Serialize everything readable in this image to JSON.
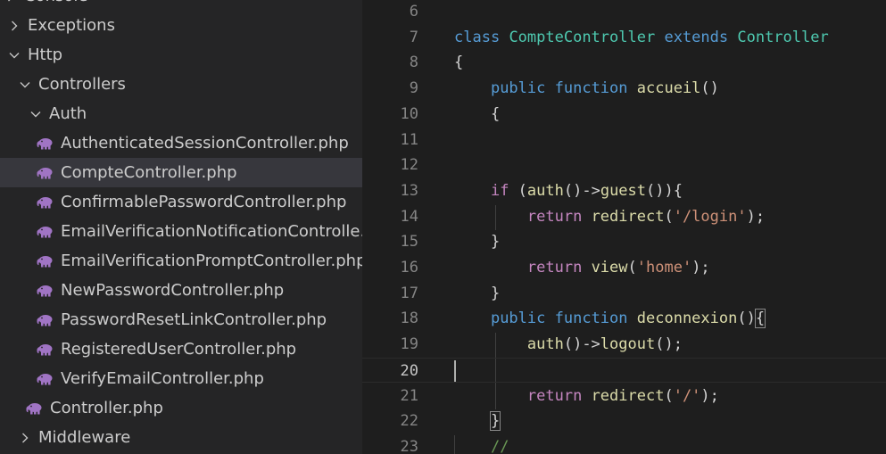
{
  "colors": {
    "sidebar_bg": "#252526",
    "editor_bg": "#1e1e1e",
    "selected_row": "#37373d",
    "php_icon": "#a074c4",
    "keyword": "#569cd6",
    "control_keyword": "#c586c0",
    "class_name": "#4ec9b0",
    "function_name": "#dcdcaa",
    "string": "#ce9178",
    "comment": "#6a9955"
  },
  "explorer": {
    "items": [
      {
        "label": "Console",
        "icon": "chevron-right-icon"
      },
      {
        "label": "Exceptions",
        "icon": "chevron-right-icon"
      },
      {
        "label": "Http",
        "icon": "chevron-down-icon"
      },
      {
        "label": "Controllers",
        "icon": "chevron-down-icon"
      },
      {
        "label": "Auth",
        "icon": "chevron-down-icon"
      },
      {
        "label": "AuthenticatedSessionController.php",
        "icon": "php-elephant-icon"
      },
      {
        "label": "CompteController.php",
        "icon": "php-elephant-icon",
        "selected": true
      },
      {
        "label": "ConfirmablePasswordController.php",
        "icon": "php-elephant-icon"
      },
      {
        "label": "EmailVerificationNotificationControlle...",
        "icon": "php-elephant-icon"
      },
      {
        "label": "EmailVerificationPromptController.php",
        "icon": "php-elephant-icon"
      },
      {
        "label": "NewPasswordController.php",
        "icon": "php-elephant-icon"
      },
      {
        "label": "PasswordResetLinkController.php",
        "icon": "php-elephant-icon"
      },
      {
        "label": "RegisteredUserController.php",
        "icon": "php-elephant-icon"
      },
      {
        "label": "VerifyEmailController.php",
        "icon": "php-elephant-icon"
      },
      {
        "label": "Controller.php",
        "icon": "php-elephant-icon"
      },
      {
        "label": "Middleware",
        "icon": "chevron-right-icon"
      }
    ]
  },
  "editor": {
    "active_line": "20",
    "lines": [
      {
        "n": "6",
        "tokens": []
      },
      {
        "n": "7",
        "tokens": [
          {
            "t": "class",
            "c": "kw"
          },
          {
            "t": " "
          },
          {
            "t": "CompteController",
            "c": "cls"
          },
          {
            "t": " "
          },
          {
            "t": "extends",
            "c": "kw"
          },
          {
            "t": " "
          },
          {
            "t": "Controller",
            "c": "cls"
          }
        ]
      },
      {
        "n": "8",
        "tokens": [
          {
            "t": "{"
          }
        ]
      },
      {
        "n": "9",
        "tokens": [
          {
            "t": "    "
          },
          {
            "t": "public",
            "c": "kw"
          },
          {
            "t": " "
          },
          {
            "t": "function",
            "c": "kw"
          },
          {
            "t": " "
          },
          {
            "t": "accueil",
            "c": "fn"
          },
          {
            "t": "()"
          }
        ]
      },
      {
        "n": "10",
        "tokens": [
          {
            "t": "    {"
          }
        ]
      },
      {
        "n": "11",
        "tokens": []
      },
      {
        "n": "12",
        "tokens": []
      },
      {
        "n": "13",
        "tokens": [
          {
            "t": "    "
          },
          {
            "t": "if",
            "c": "kw2"
          },
          {
            "t": " ("
          },
          {
            "t": "auth",
            "c": "fn"
          },
          {
            "t": "()->"
          },
          {
            "t": "guest",
            "c": "fn"
          },
          {
            "t": "()){"
          }
        ]
      },
      {
        "n": "14",
        "tokens": [
          {
            "t": "        "
          },
          {
            "t": "return",
            "c": "kw2"
          },
          {
            "t": " "
          },
          {
            "t": "redirect",
            "c": "fn"
          },
          {
            "t": "("
          },
          {
            "t": "'/login'",
            "c": "str"
          },
          {
            "t": ");"
          }
        ]
      },
      {
        "n": "15",
        "tokens": [
          {
            "t": "    }"
          }
        ]
      },
      {
        "n": "16",
        "tokens": [
          {
            "t": "        "
          },
          {
            "t": "return",
            "c": "kw2"
          },
          {
            "t": " "
          },
          {
            "t": "view",
            "c": "fn"
          },
          {
            "t": "("
          },
          {
            "t": "'home'",
            "c": "str"
          },
          {
            "t": ");"
          }
        ]
      },
      {
        "n": "17",
        "tokens": [
          {
            "t": "    }"
          }
        ]
      },
      {
        "n": "18",
        "tokens": [
          {
            "t": "    "
          },
          {
            "t": "public",
            "c": "kw"
          },
          {
            "t": " "
          },
          {
            "t": "function",
            "c": "kw"
          },
          {
            "t": " "
          },
          {
            "t": "deconnexion",
            "c": "fn"
          },
          {
            "t": "()"
          },
          {
            "t": "{",
            "c": "br"
          }
        ]
      },
      {
        "n": "19",
        "tokens": [
          {
            "t": "        "
          },
          {
            "t": "auth",
            "c": "fn"
          },
          {
            "t": "()->"
          },
          {
            "t": "logout",
            "c": "fn"
          },
          {
            "t": "();"
          }
        ]
      },
      {
        "n": "20",
        "tokens": []
      },
      {
        "n": "21",
        "tokens": [
          {
            "t": "        "
          },
          {
            "t": "return",
            "c": "kw2"
          },
          {
            "t": " "
          },
          {
            "t": "redirect",
            "c": "fn"
          },
          {
            "t": "("
          },
          {
            "t": "'/'",
            "c": "str"
          },
          {
            "t": ");"
          }
        ]
      },
      {
        "n": "22",
        "tokens": [
          {
            "t": "    "
          },
          {
            "t": "}",
            "c": "br"
          }
        ]
      },
      {
        "n": "23",
        "tokens": [
          {
            "t": "    "
          },
          {
            "t": "//",
            "c": "cm"
          }
        ]
      }
    ]
  }
}
